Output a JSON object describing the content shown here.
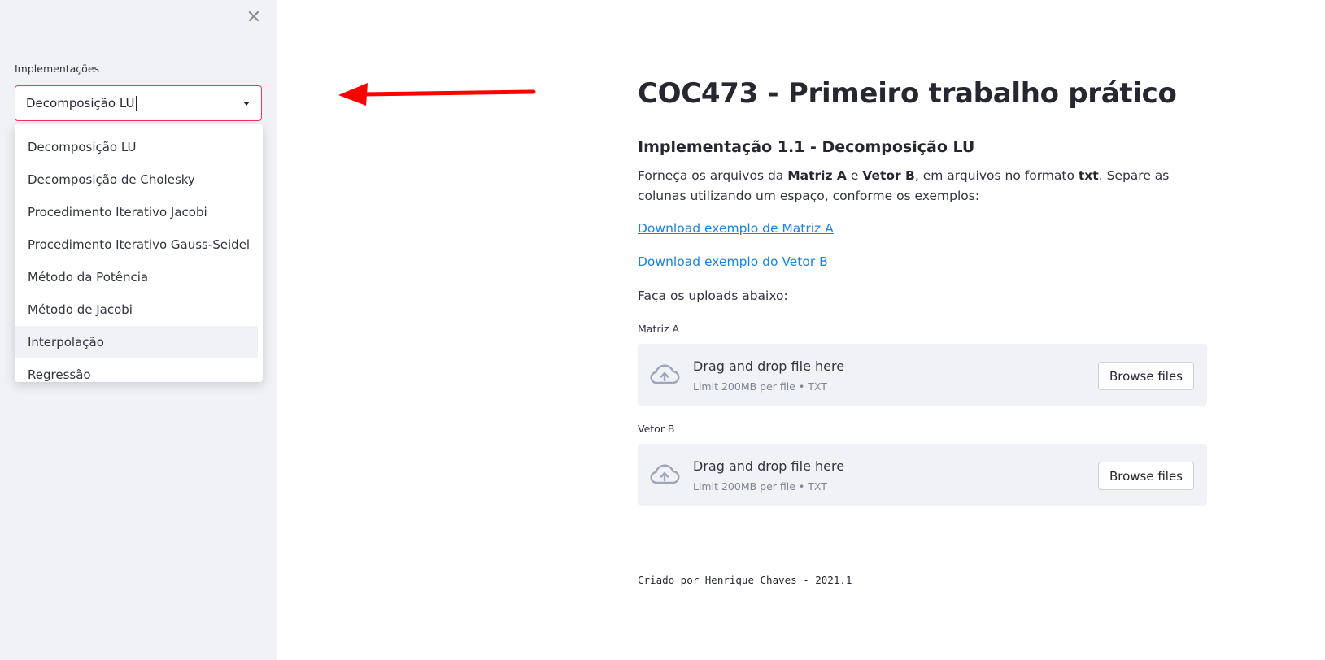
{
  "sidebar": {
    "close_icon": "✕",
    "select_label": "Implementações",
    "selected_value": "Decomposição LU",
    "options": [
      "Decomposição LU",
      "Decomposição de Cholesky",
      "Procedimento Iterativo Jacobi",
      "Procedimento Iterativo Gauss-Seidel",
      "Método da Potência",
      "Método de Jacobi",
      "Interpolação",
      "Regressão"
    ],
    "highlighted_option_index": 6
  },
  "annotation": {
    "arrow_color": "#ff0000"
  },
  "main": {
    "title": "COC473 - Primeiro trabalho prático",
    "subtitle": "Implementação 1.1 - Decomposição LU",
    "intro": {
      "t1": "Forneça os arquivos da ",
      "b1": "Matriz A",
      "t2": " e ",
      "b2": "Vetor B",
      "t3": ", em arquivos no formato ",
      "b3": "txt",
      "t4": ". Separe as colunas utilizando um espaço, conforme os exemplos:"
    },
    "link_matrix": "Download exemplo de Matriz A",
    "link_vector": "Download exemplo do Vetor B",
    "uploads_text": "Faça os uploads abaixo:",
    "uploaders": [
      {
        "label": "Matriz A",
        "drop_text": "Drag and drop file here",
        "limit_text": "Limit 200MB per file • TXT",
        "button": "Browse files"
      },
      {
        "label": "Vetor B",
        "drop_text": "Drag and drop file here",
        "limit_text": "Limit 200MB per file • TXT",
        "button": "Browse files"
      }
    ],
    "footer": "Criado por Henrique Chaves - 2021.1"
  },
  "colors": {
    "accent": "#f63366",
    "link": "#1c83e1",
    "sidebar_bg": "#f0f2f6"
  }
}
